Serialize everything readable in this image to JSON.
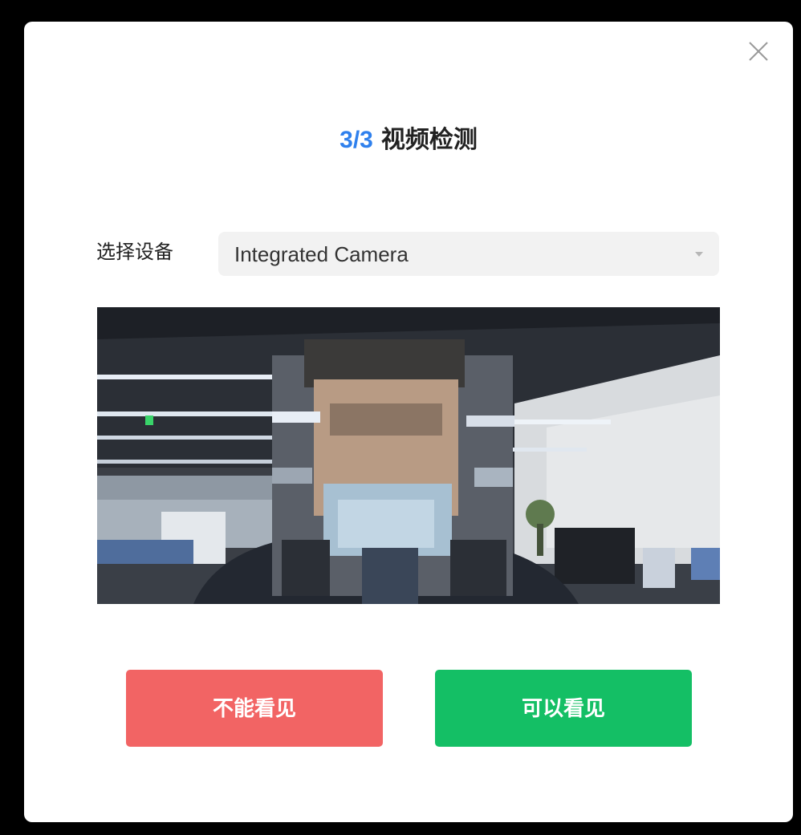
{
  "dialog": {
    "step": "3/3",
    "title": "视频检测",
    "device_label": "选择设备",
    "device_value": "Integrated Camera",
    "cannot_see_label": "不能看见",
    "can_see_label": "可以看见"
  },
  "icons": {
    "close": "close-icon",
    "dropdown": "caret-down-icon"
  },
  "colors": {
    "step": "#2f80ed",
    "cannot_see_button": "#f26464",
    "can_see_button": "#14bf65",
    "select_background": "#f2f2f2"
  }
}
